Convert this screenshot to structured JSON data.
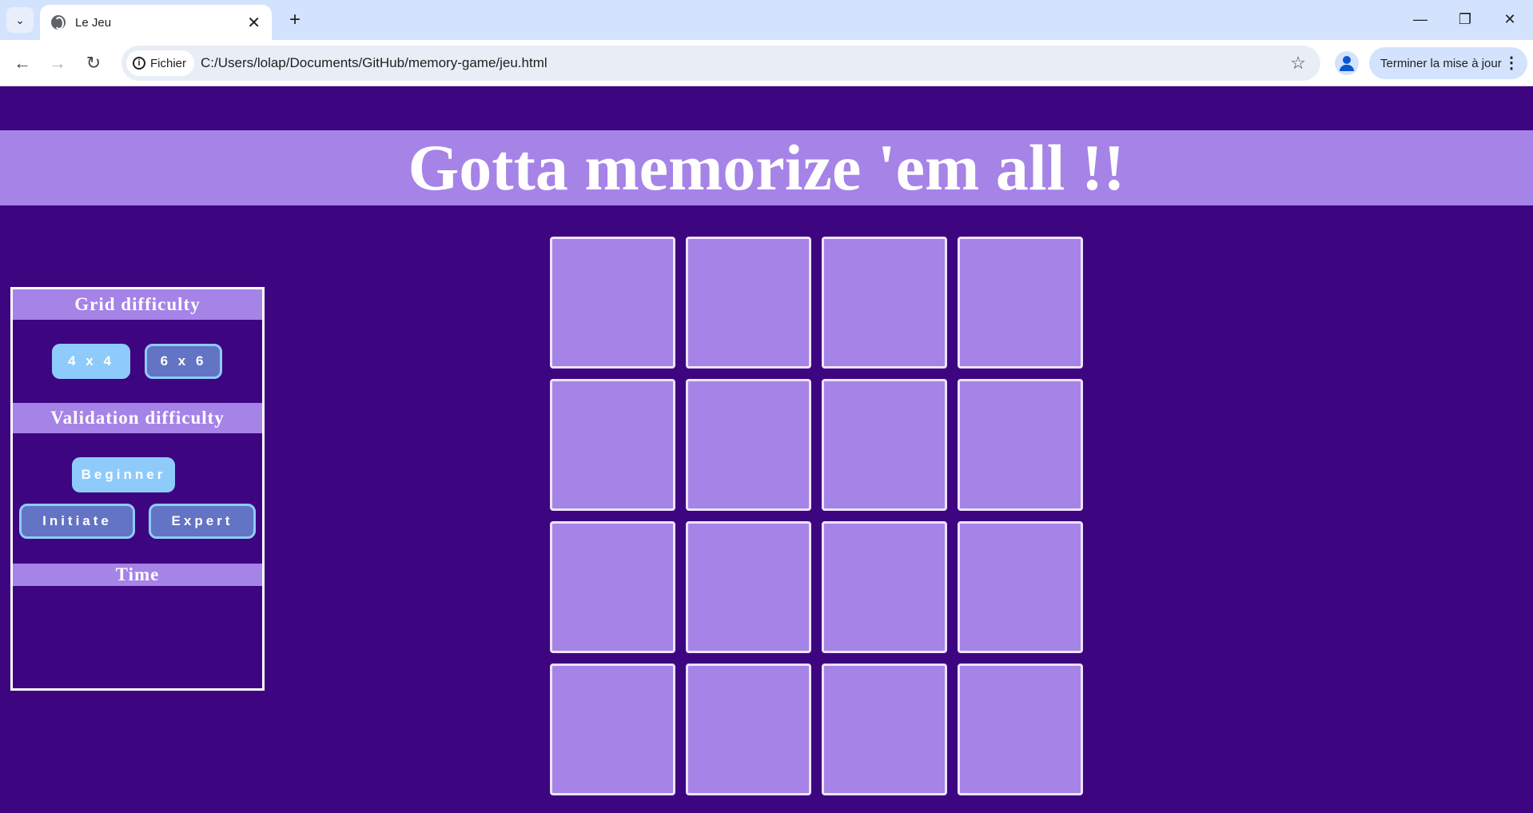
{
  "browser": {
    "tab_title": "Le Jeu",
    "site_chip": "Fichier",
    "url": "C:/Users/lolap/Documents/GitHub/memory-game/jeu.html",
    "update_button": "Terminer la mise à jour"
  },
  "page": {
    "title": "Gotta memorize 'em all !!"
  },
  "panel": {
    "grid_heading": "Grid difficulty",
    "grid_options": [
      "4 x 4",
      "6 x 6"
    ],
    "grid_selected": "4 x 4",
    "validation_heading": "Validation difficulty",
    "validation_options": [
      "Beginner",
      "Initiate",
      "Expert"
    ],
    "validation_selected": "Beginner",
    "time_heading": "Time",
    "time_value": ""
  },
  "board": {
    "rows": 4,
    "columns": 4,
    "cards_face_down": 16
  },
  "colors": {
    "background": "#3d0580",
    "accent": "#a683e7",
    "active_button": "#8ecbfa",
    "inactive_button": "#6374c4"
  }
}
